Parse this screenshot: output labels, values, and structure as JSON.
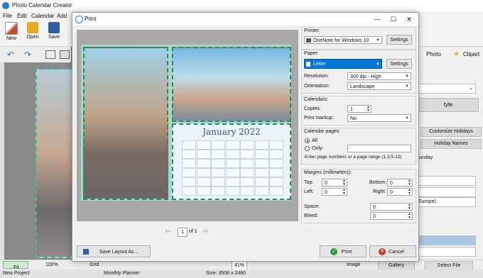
{
  "app": {
    "title": "Photo Calendar Creator",
    "menu": [
      "File",
      "Edit",
      "Calendar",
      "Add"
    ],
    "toolbar": [
      {
        "label": "New",
        "icon": "new-document-icon"
      },
      {
        "label": "Open",
        "icon": "folder-open-icon"
      },
      {
        "label": "Save",
        "icon": "save-disk-icon"
      }
    ],
    "right_panel": {
      "tabs": [
        "Photo",
        "Clipart"
      ],
      "buttons": [
        "Customize Holidays",
        "Holiday Names"
      ],
      "partial_texts": {
        "style": "tyle",
        "weekday": "unday",
        "region": "Europe)"
      },
      "bottom_buttons": [
        "Gallery",
        "Select File"
      ]
    },
    "bottom_bar": {
      "fit": "Fit",
      "zoom": "100%",
      "grid": "Grid",
      "zoom_field": "41%",
      "image_option": "Image"
    },
    "status": {
      "project": "New Project",
      "type": "Monthly Planner",
      "size": "Size: 3508 x 2480"
    }
  },
  "dialog": {
    "title": "Print",
    "calendar_title": "January 2022",
    "page_number": "1",
    "page_total": "of 1",
    "printer": {
      "label": "Printer:",
      "value": "OneNote for Windows 10",
      "settings": "Settings"
    },
    "paper": {
      "label": "Paper:",
      "value": "Letter",
      "settings": "Settings",
      "resolution_label": "Resolution:",
      "resolution_value": "300 dpi - High",
      "orientation_label": "Orientation:",
      "orientation_value": "Landscape"
    },
    "calendars": {
      "label": "Calendars:",
      "copies_label": "Copies:",
      "copies_value": "1",
      "markup_label": "Print markup:",
      "markup_value": "No"
    },
    "calendar_pages": {
      "label": "Calendar pages:",
      "all_label": "All",
      "only_label": "Only:",
      "hint": "Enter page numbers or a page range (1,3,5-12)"
    },
    "margins": {
      "label": "Margins (millimeters):",
      "top_label": "Top:",
      "top_value": "0",
      "left_label": "Left:",
      "left_value": "0",
      "bottom_label": "Bottom:",
      "bottom_value": "0",
      "right_label": "Right:",
      "right_value": "0",
      "space_label": "Space:",
      "space_value": "0",
      "bleed_label": "Bleed:",
      "bleed_value": "0"
    },
    "footer": {
      "save_layout": "Save Layout As...",
      "print": "Print",
      "cancel": "Cancel"
    },
    "colors": {
      "accent": "#0078d7",
      "frame": "#2e8a66",
      "print_icon": "#2e9c3a",
      "cancel_icon": "#d23b2b"
    }
  }
}
